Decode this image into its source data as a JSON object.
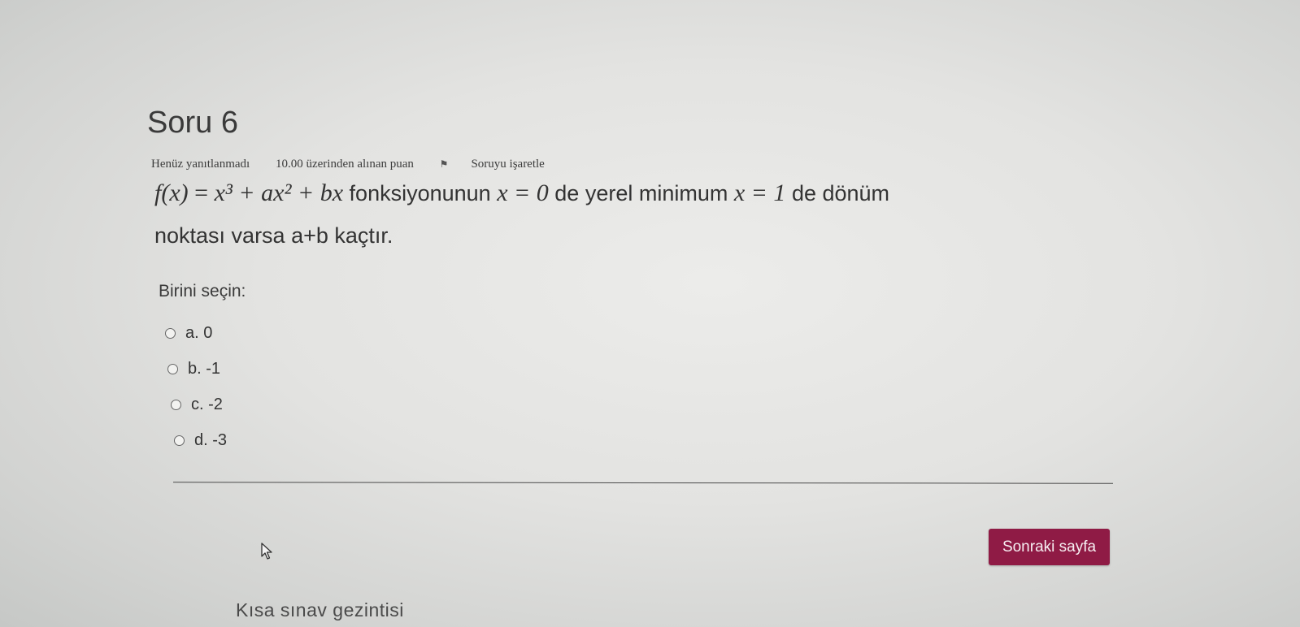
{
  "question": {
    "title": "Soru 6",
    "status": "Henüz yanıtlanmadı",
    "mark": "10.00 üzerinden alınan puan",
    "flag_label": "Soruyu işaretle",
    "text": {
      "func_lhs": "f(x)",
      "func_rhs": "x³ + ax² + bx",
      "part1": "fonksiyonunun",
      "cond1": "x = 0",
      "part2": "de yerel minimum",
      "cond2": "x = 1",
      "part3": "de dönüm",
      "line2": "noktası varsa a+b kaçtır."
    },
    "prompt": "Birini seçin:",
    "options": [
      {
        "letter": "a.",
        "value": "0"
      },
      {
        "letter": "b.",
        "value": "-1"
      },
      {
        "letter": "c.",
        "value": "-2"
      },
      {
        "letter": "d.",
        "value": "-3"
      }
    ]
  },
  "footer": {
    "next_button": "Sonraki sayfa",
    "nav_link": "Kısa sınav gezintisi"
  },
  "colors": {
    "next_button_bg": "#8f1b45",
    "background": "#e3e3e1"
  },
  "icons": {
    "flag": "flag-icon",
    "cursor": "mouse-cursor-icon",
    "radio": "radio-button"
  }
}
